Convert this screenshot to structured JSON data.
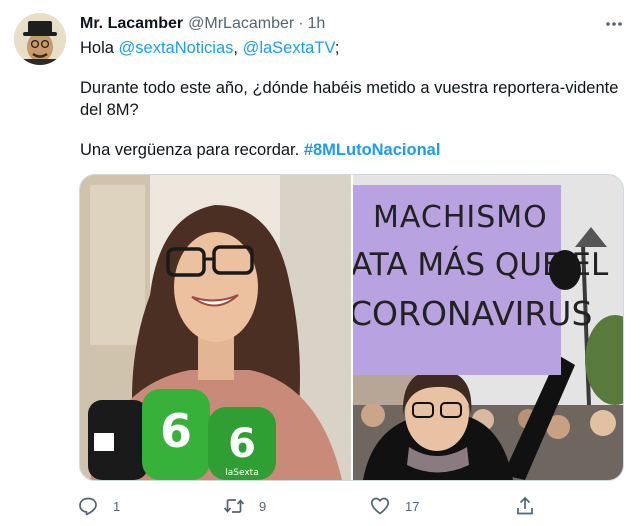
{
  "author": {
    "display_name": "Mr. Lacamber",
    "handle": "@MrLacamber",
    "separator": "·",
    "timestamp": "1h"
  },
  "tweet": {
    "line1": {
      "greeting": "Hola ",
      "mention1": "@sextaNoticias",
      "sep": ", ",
      "mention2": "@laSextaTV",
      "end": ";"
    },
    "line2": "Durante todo este año, ¿dónde habéis metido a vuestra reportera-vidente del 8M?",
    "line3": {
      "text": "Una vergüenza para recordar. ",
      "hashtag": "#8MLutoNacional"
    }
  },
  "media": {
    "right_sign_lines": [
      "MACHISMO",
      "ATA MÁS QUE EL",
      "CORONAVIRUS"
    ],
    "left_mic_logo": "6",
    "left_mic_small": "laSexta"
  },
  "actions": {
    "reply_count": "1",
    "retweet_count": "9",
    "like_count": "17"
  },
  "colors": {
    "link": "#1d9bf0",
    "secondary": "#536471",
    "sign_purple": "#b8a2df"
  },
  "icons": [
    "more-icon",
    "reply-icon",
    "retweet-icon",
    "like-icon",
    "share-icon"
  ]
}
